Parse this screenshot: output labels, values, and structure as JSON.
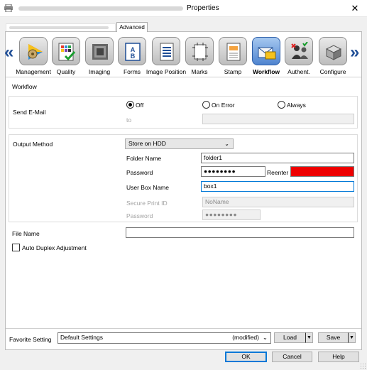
{
  "window": {
    "title": "Properties",
    "close_glyph": "✕"
  },
  "tabs": {
    "advanced_label": "Advanced"
  },
  "categories": [
    {
      "label": "Management",
      "icon": "management-icon"
    },
    {
      "label": "Quality",
      "icon": "quality-icon"
    },
    {
      "label": "Imaging",
      "icon": "imaging-icon"
    },
    {
      "label": "Forms",
      "icon": "forms-icon"
    },
    {
      "label": "Image Position",
      "icon": "image-position-icon"
    },
    {
      "label": "Marks",
      "icon": "marks-icon"
    },
    {
      "label": "Stamp",
      "icon": "stamp-icon"
    },
    {
      "label": "Workflow",
      "icon": "workflow-icon",
      "active": true
    },
    {
      "label": "Authent.",
      "icon": "authentication-icon"
    },
    {
      "label": "Configure",
      "icon": "configure-icon"
    }
  ],
  "nav": {
    "prev_glyph": "«",
    "next_glyph": "»"
  },
  "workflow": {
    "section_label": "Workflow",
    "send_email": {
      "label": "Send E-Mail",
      "options": [
        "Off",
        "On Error",
        "Always"
      ],
      "selected": "Off",
      "to_label": "to",
      "to_value": ""
    },
    "output": {
      "label": "Output Method",
      "method": "Store on HDD",
      "folder_name_label": "Folder Name",
      "folder_name": "folder1",
      "password_label": "Password",
      "password": "●●●●●●●●",
      "reenter_label": "Reenter",
      "reenter_status_color": "#ee0000",
      "user_box_label": "User Box Name",
      "user_box": "box1",
      "secure_print_label": "Secure Print ID",
      "secure_print_id": "NoName",
      "secure_password_label": "Password",
      "secure_password": "●●●●●●●●"
    },
    "file_name": {
      "label": "File Name",
      "value": ""
    },
    "auto_duplex": {
      "label": "Auto Duplex Adjustment",
      "checked": false
    }
  },
  "footer": {
    "favorite_label": "Favorite Setting",
    "favorite_value": "Default Settings",
    "favorite_state": "(modified)",
    "load_label": "Load",
    "save_label": "Save",
    "ok_label": "OK",
    "cancel_label": "Cancel",
    "help_label": "Help"
  },
  "colors": {
    "accent": "#1f4e96",
    "focus": "#0078d7",
    "active_icon": "#4f84cf"
  }
}
